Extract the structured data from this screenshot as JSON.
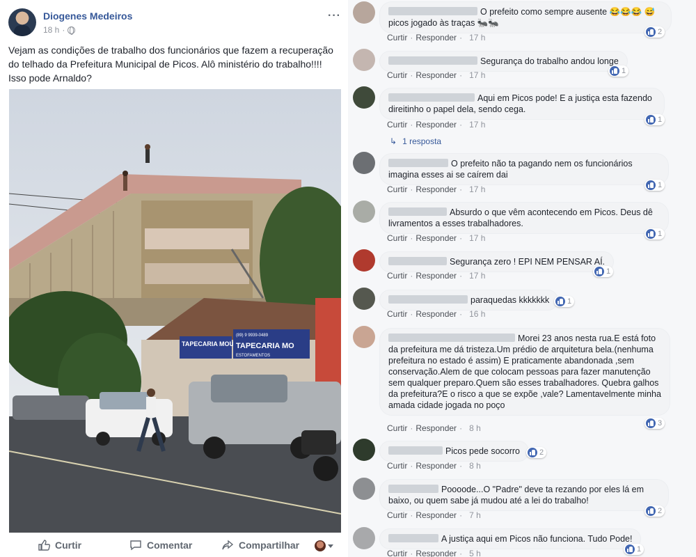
{
  "post": {
    "author": "Diogenes Medeiros",
    "time": "18 h",
    "time_sep": "·",
    "more": "···",
    "text": "Vejam as condições de trabalho dos funcionários que fazem a recuperação do telhado da Prefeitura Municipal de Picos. Alô ministério do trabalho!!!! Isso pode Arnaldo?",
    "photo_signs": [
      "TAPECARIA MOURA",
      "TAPECARIA MO",
      "(89) 9 9939-0489",
      "ESTOFAMENTOS"
    ],
    "actions": {
      "like": "Curtir",
      "comment": "Comentar",
      "share": "Compartilhar"
    }
  },
  "comments": [
    {
      "text": "O prefeito como sempre ausente 😂😂😂 😅picos jogado às traças 🐜🐜",
      "like": "Curtir",
      "reply": "Responder",
      "time": "17 h",
      "reactions": "2"
    },
    {
      "text": "Segurança do trabalho andou longe",
      "like": "Curtir",
      "reply": "Responder",
      "time": "17 h",
      "reactions": "1"
    },
    {
      "text": "Aqui em Picos pode! E a justiça esta fazendo direitinho o papel dela, sendo cega.",
      "like": "Curtir",
      "reply": "Responder",
      "time": "17 h",
      "reactions": "1",
      "replies_label": "1 resposta"
    },
    {
      "text": "O prefeito não ta pagando nem os funcionários imagina esses ai se caírem dai",
      "like": "Curtir",
      "reply": "Responder",
      "time": "17 h",
      "reactions": "1"
    },
    {
      "text": "Absurdo o que vêm acontecendo em Picos. Deus dê livramentos a esses trabalhadores.",
      "like": "Curtir",
      "reply": "Responder",
      "time": "17 h",
      "reactions": "1"
    },
    {
      "text": "Segurança zero ! EPI NEM PENSAR AÍ.",
      "like": "Curtir",
      "reply": "Responder",
      "time": "17 h",
      "reactions": "1"
    },
    {
      "text": "paraquedas kkkkkkk",
      "like": "Curtir",
      "reply": "Responder",
      "time": "16 h",
      "reactions": "1"
    },
    {
      "text": "Morei 23 anos nesta rua.E está foto da prefeitura me dá tristeza.Um prédio de arquitetura bela.(nenhuma prefeitura no estado é assim) E praticamente abandonada ,sem conservação.Alem de que colocam pessoas para fazer manutenção sem qualquer preparo.Quem são esses trabalhadores. Quebra galhos da prefeitura?E o risco a que se expõe ,vale? Lamentavelmente minha amada cidade jogada no poço",
      "like": "Curtir",
      "reply": "Responder",
      "time": "8 h",
      "reactions": "3"
    },
    {
      "text": "Picos pede socorro",
      "like": "Curtir",
      "reply": "Responder",
      "time": "8 h",
      "reactions": "2"
    },
    {
      "text": "Poooode...O \"Padre\" deve ta rezando por eles lá em baixo, ou quem sabe já mudou até a lei do trabalho!",
      "like": "Curtir",
      "reply": "Responder",
      "time": "7 h",
      "reactions": "2"
    },
    {
      "text": "A justiça aqui em Picos não funciona. Tudo Pode!",
      "like": "Curtir",
      "reply": "Responder",
      "time": "5 h",
      "reactions": "1"
    }
  ],
  "colors": {
    "link_blue": "#365899",
    "like_blue": "#4267b2",
    "muted": "#90949c"
  }
}
